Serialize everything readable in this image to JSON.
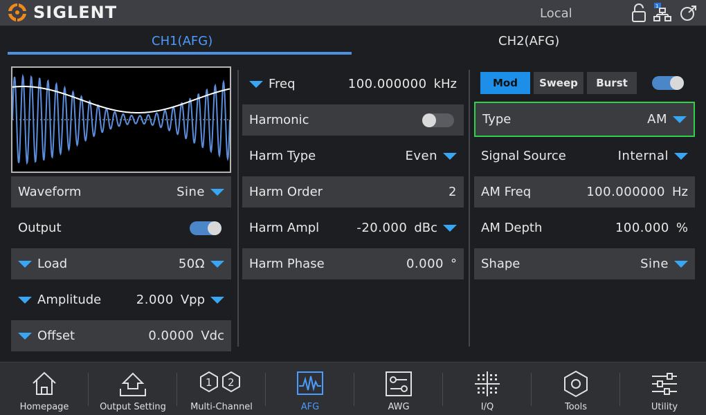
{
  "brand": {
    "name": "SIGLENT"
  },
  "status": {
    "mode": "Local",
    "network_badge": "1"
  },
  "tabs": {
    "ch1": "CH1(AFG)",
    "ch2": "CH2(AFG)"
  },
  "left": {
    "waveform": {
      "label": "Waveform",
      "value": "Sine"
    },
    "output": {
      "label": "Output",
      "on": true
    },
    "load": {
      "label": "Load",
      "value": "50Ω"
    },
    "amplitude": {
      "label": "Amplitude",
      "value": "2.000",
      "unit": "Vpp"
    },
    "offset": {
      "label": "Offset",
      "value": "0.0000",
      "unit": "Vdc"
    }
  },
  "middle": {
    "freq": {
      "label": "Freq",
      "value": "100.000000",
      "unit": "kHz"
    },
    "harmonic": {
      "label": "Harmonic",
      "on": false
    },
    "harm_type": {
      "label": "Harm Type",
      "value": "Even"
    },
    "harm_order": {
      "label": "Harm Order",
      "value": "2"
    },
    "harm_ampl": {
      "label": "Harm Ampl",
      "value": "-20.000",
      "unit": "dBc"
    },
    "harm_phase": {
      "label": "Harm Phase",
      "value": "0.000",
      "unit": "°"
    }
  },
  "right": {
    "mod_tabs": [
      "Mod",
      "Sweep",
      "Burst"
    ],
    "mod_enabled": true,
    "type": {
      "label": "Type",
      "value": "AM"
    },
    "signal_source": {
      "label": "Signal Source",
      "value": "Internal"
    },
    "am_freq": {
      "label": "AM Freq",
      "value": "100.000000",
      "unit": "Hz"
    },
    "am_depth": {
      "label": "AM Depth",
      "value": "100.000",
      "unit": "%"
    },
    "shape": {
      "label": "Shape",
      "value": "Sine"
    }
  },
  "nav": [
    {
      "label": "Homepage",
      "icon": "home-icon"
    },
    {
      "label": "Output Setting",
      "icon": "output-setting-icon"
    },
    {
      "label": "Multi-Channel",
      "icon": "multi-channel-icon"
    },
    {
      "label": "AFG",
      "icon": "afg-icon"
    },
    {
      "label": "AWG",
      "icon": "awg-icon"
    },
    {
      "label": "I/Q",
      "icon": "iq-icon"
    },
    {
      "label": "Tools",
      "icon": "tools-icon"
    },
    {
      "label": "Utility",
      "icon": "utility-icon"
    }
  ],
  "colors": {
    "accent": "#1e8fe8",
    "highlight": "#2fd24a",
    "triangle": "#38a6f2",
    "wave": "#5b8ddc"
  }
}
